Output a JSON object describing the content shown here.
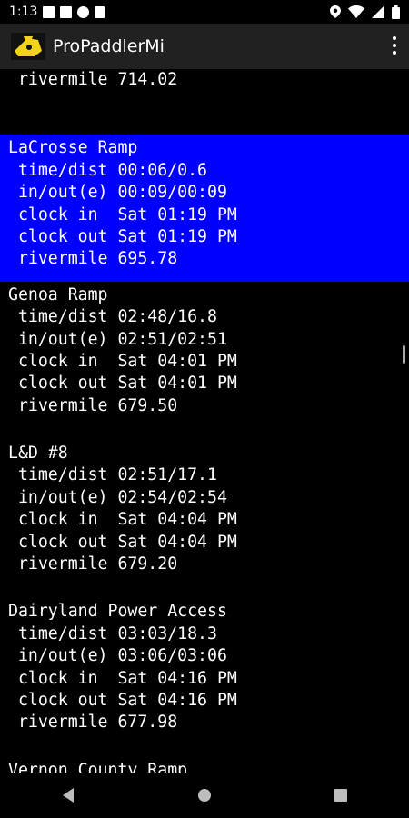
{
  "status": {
    "time": "1:13"
  },
  "app": {
    "title": "ProPaddlerMi"
  },
  "top_line": " rivermile 714.02",
  "entries": [
    {
      "name": "LaCrosse Ramp",
      "time_dist": " time/dist 00:06/0.6",
      "in_out": " in/out(e) 00:09/00:09",
      "clock_in": " clock in  Sat 01:19 PM",
      "clock_out": " clock out Sat 01:19 PM",
      "rivermile": " rivermile 695.78"
    },
    {
      "name": "Genoa Ramp",
      "time_dist": " time/dist 02:48/16.8",
      "in_out": " in/out(e) 02:51/02:51",
      "clock_in": " clock in  Sat 04:01 PM",
      "clock_out": " clock out Sat 04:01 PM",
      "rivermile": " rivermile 679.50"
    },
    {
      "name": "L&D #8",
      "time_dist": " time/dist 02:51/17.1",
      "in_out": " in/out(e) 02:54/02:54",
      "clock_in": " clock in  Sat 04:04 PM",
      "clock_out": " clock out Sat 04:04 PM",
      "rivermile": " rivermile 679.20"
    },
    {
      "name": "Dairyland Power Access",
      "time_dist": " time/dist 03:03/18.3",
      "in_out": " in/out(e) 03:06/03:06",
      "clock_in": " clock in  Sat 04:16 PM",
      "clock_out": " clock out Sat 04:16 PM",
      "rivermile": " rivermile 677.98"
    },
    {
      "name": "Vernon County Ramp"
    }
  ],
  "colors": {
    "selected_bg": "#0000ff",
    "app_bar": "#212121",
    "background": "#000000"
  }
}
